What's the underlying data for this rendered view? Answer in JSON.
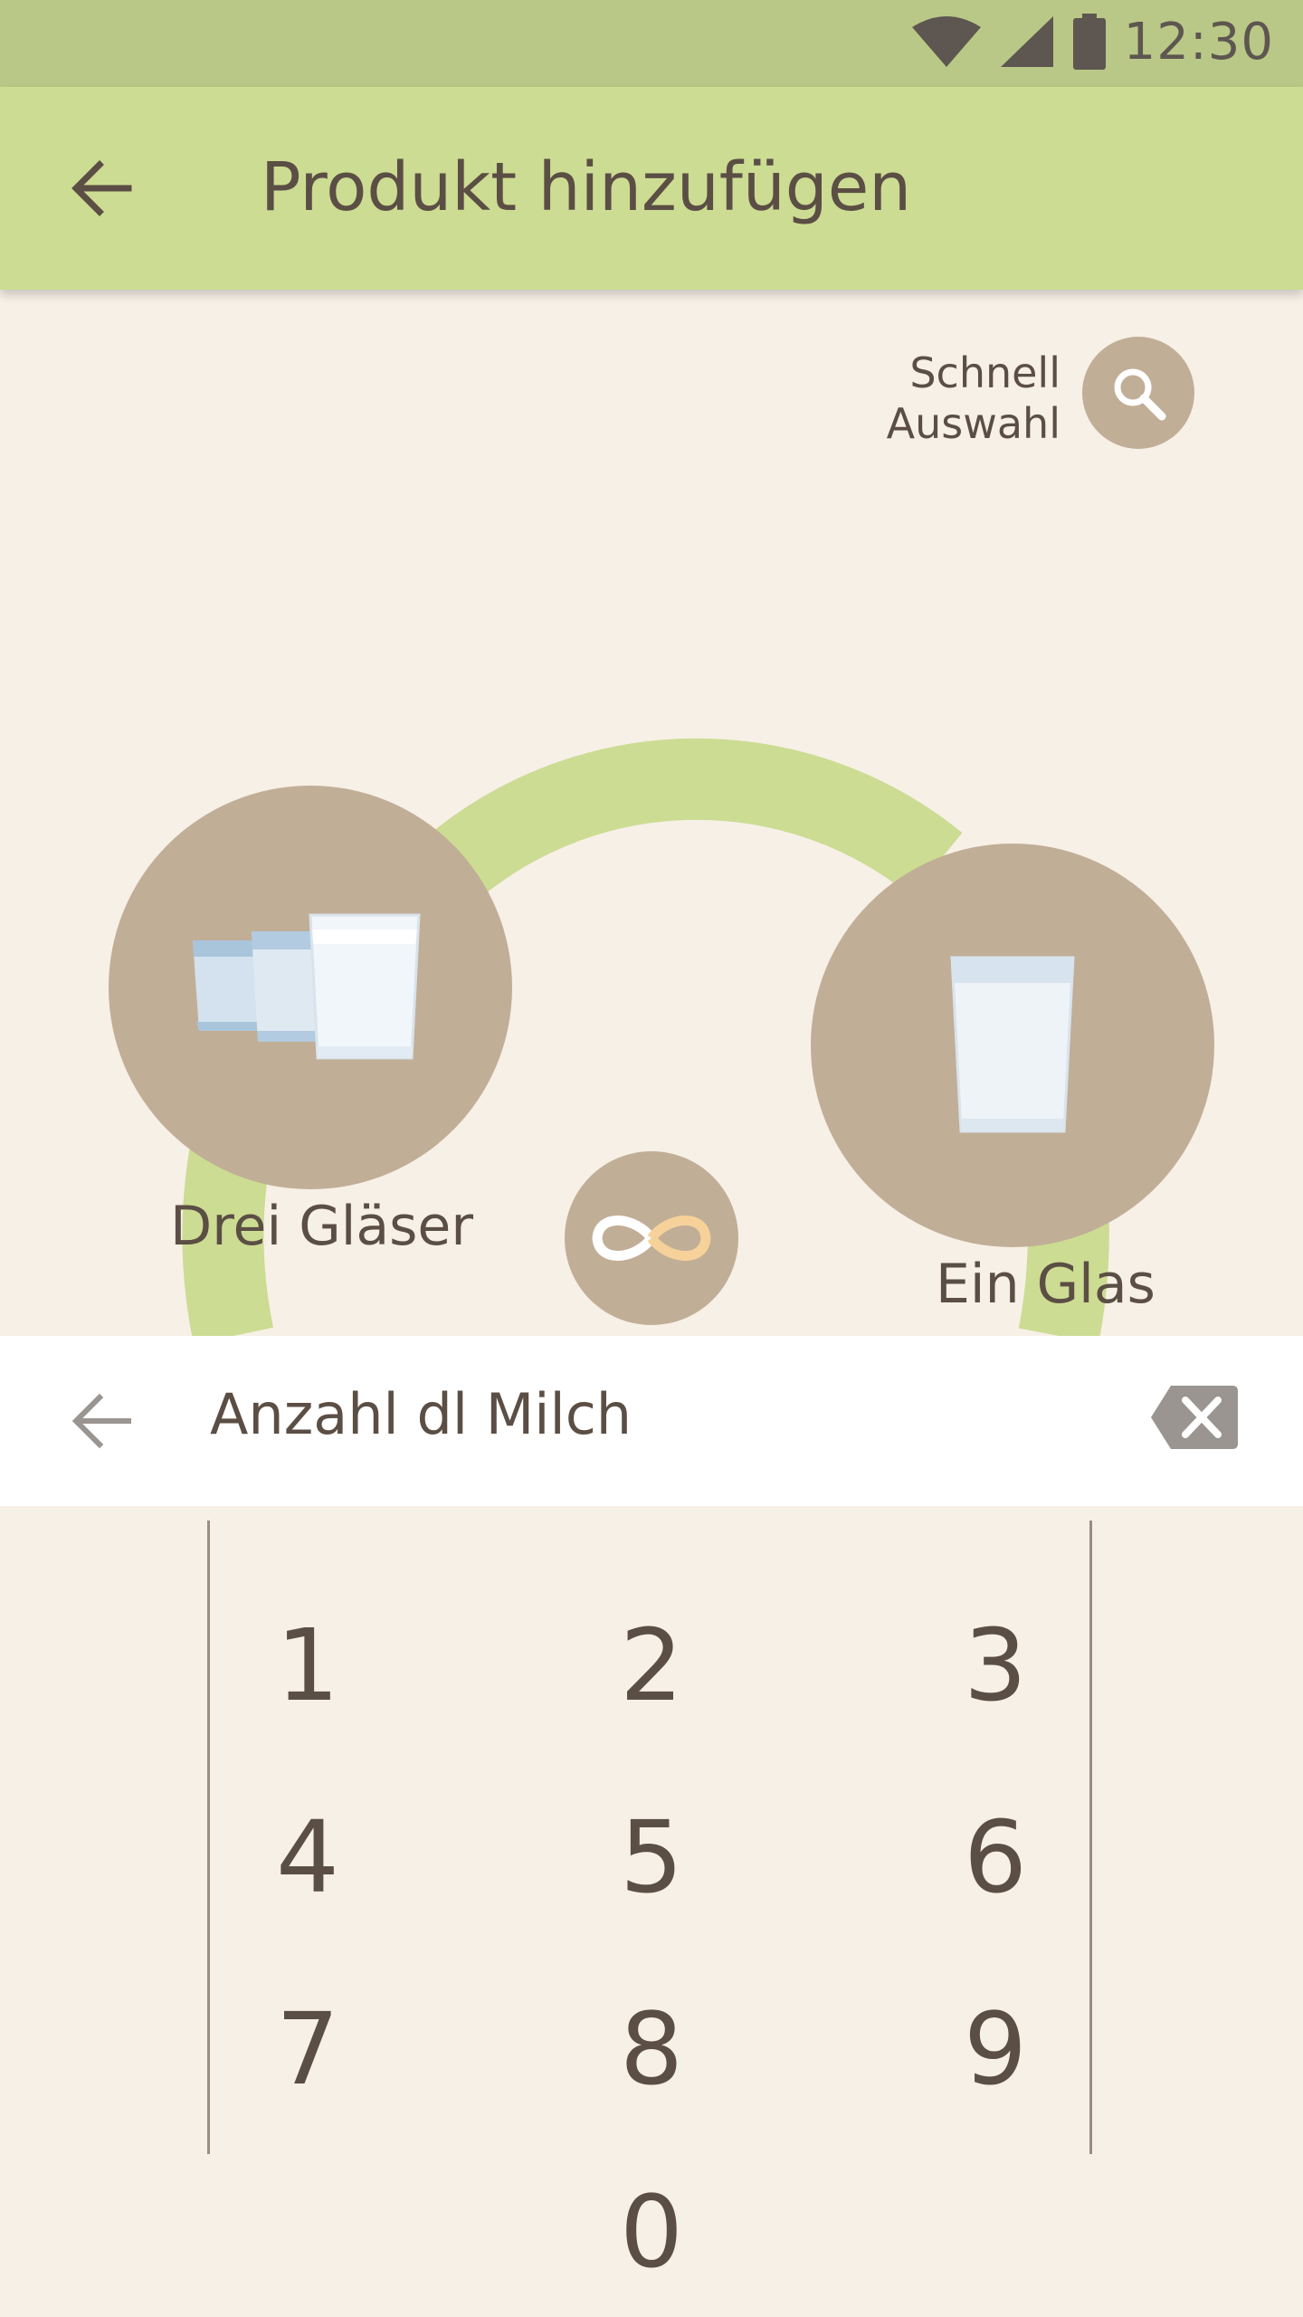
{
  "status_bar": {
    "time": "12:30",
    "icons": [
      "wifi-icon",
      "cell-signal-icon",
      "battery-icon"
    ]
  },
  "app_bar": {
    "back_icon": "arrow-back-icon",
    "title": "Produkt hinzufügen"
  },
  "quick_select": {
    "label_line1": "Schnell",
    "label_line2": "Auswahl",
    "icon": "search-icon"
  },
  "options": {
    "three_glasses_label": "Drei Gläser",
    "one_glass_label": "Ein Glas",
    "infinity_icon": "infinity-icon"
  },
  "input": {
    "back_icon": "arrow-back-icon",
    "label": "Anzahl dl Milch",
    "clear_icon": "backspace-icon"
  },
  "keypad": {
    "keys": [
      "1",
      "2",
      "3",
      "4",
      "5",
      "6",
      "7",
      "8",
      "9",
      "0"
    ]
  },
  "colors": {
    "status_bar": "#b9c887",
    "app_bar": "#ccdc93",
    "background": "#f7f0e7",
    "circle": "#c1ae96",
    "arc": "#ccdc93",
    "text": "#5b4e44"
  }
}
